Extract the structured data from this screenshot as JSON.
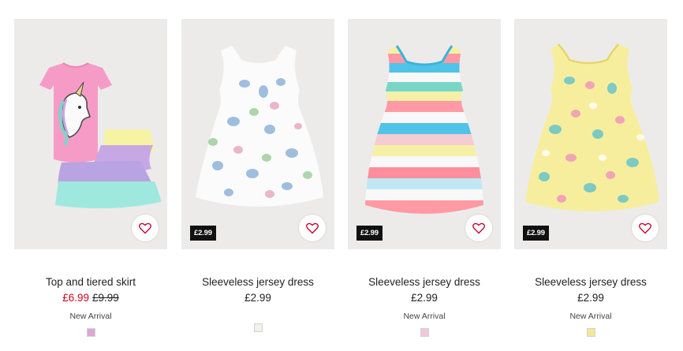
{
  "products": [
    {
      "title": "Top and tiered skirt",
      "price": "£6.99",
      "old_price": "£9.99",
      "price_tag": "",
      "badge": "New Arrival",
      "swatch_color": "#dca8d6",
      "favorite_icon": "heart-icon"
    },
    {
      "title": "Sleeveless jersey dress",
      "price": "£2.99",
      "old_price": "",
      "price_tag": "£2.99",
      "badge": "",
      "swatch_color": "#f1f1ea",
      "favorite_icon": "heart-icon"
    },
    {
      "title": "Sleeveless jersey dress",
      "price": "£2.99",
      "old_price": "",
      "price_tag": "£2.99",
      "badge": "New Arrival",
      "swatch_color": "#f2c6dc",
      "favorite_icon": "heart-icon"
    },
    {
      "title": "Sleeveless jersey dress",
      "price": "£2.99",
      "old_price": "",
      "price_tag": "£2.99",
      "badge": "New Arrival",
      "swatch_color": "#f3e79a",
      "favorite_icon": "heart-icon"
    }
  ],
  "colors": {
    "sale_price": "#d0021b",
    "heart": "#c4002f",
    "price_tag_bg": "#111111"
  }
}
